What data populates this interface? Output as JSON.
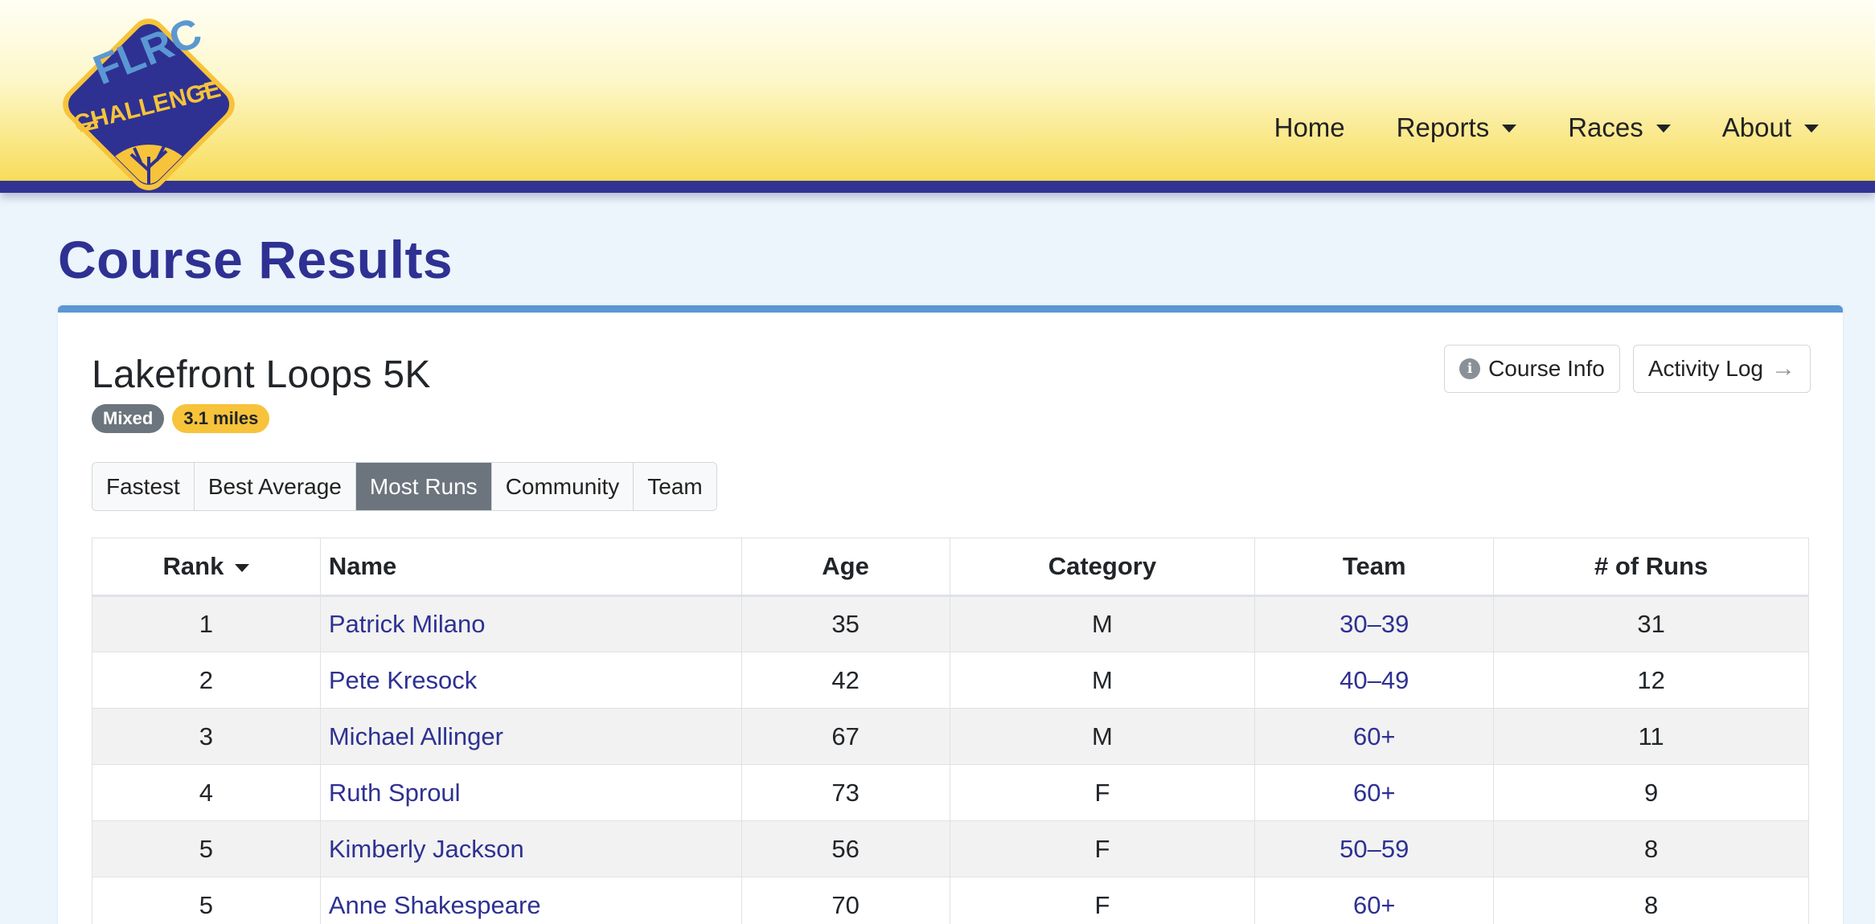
{
  "logo": {
    "line1": "FLRC",
    "line2": "CHALLENGE"
  },
  "nav": [
    {
      "label": "Home",
      "dropdown": false
    },
    {
      "label": "Reports",
      "dropdown": true
    },
    {
      "label": "Races",
      "dropdown": true
    },
    {
      "label": "About",
      "dropdown": true
    }
  ],
  "page_title": "Course Results",
  "course": {
    "name": "Lakefront Loops 5K",
    "badges": {
      "type": "Mixed",
      "distance": "3.1 miles"
    }
  },
  "buttons": {
    "course_info": "Course Info",
    "activity_log": "Activity Log"
  },
  "tabs": [
    "Fastest",
    "Best Average",
    "Most Runs",
    "Community",
    "Team"
  ],
  "active_tab": "Most Runs",
  "table": {
    "headers": {
      "rank": "Rank",
      "name": "Name",
      "age": "Age",
      "category": "Category",
      "team": "Team",
      "runs": "# of Runs"
    },
    "rows": [
      {
        "rank": "1",
        "name": "Patrick Milano",
        "age": "35",
        "category": "M",
        "team": "30–39",
        "runs": "31"
      },
      {
        "rank": "2",
        "name": "Pete Kresock",
        "age": "42",
        "category": "M",
        "team": "40–49",
        "runs": "12"
      },
      {
        "rank": "3",
        "name": "Michael Allinger",
        "age": "67",
        "category": "M",
        "team": "60+",
        "runs": "11"
      },
      {
        "rank": "4",
        "name": "Ruth Sproul",
        "age": "73",
        "category": "F",
        "team": "60+",
        "runs": "9"
      },
      {
        "rank": "5",
        "name": "Kimberly Jackson",
        "age": "56",
        "category": "F",
        "team": "50–59",
        "runs": "8"
      },
      {
        "rank": "5",
        "name": "Anne Shakespeare",
        "age": "70",
        "category": "F",
        "team": "60+",
        "runs": "8"
      }
    ]
  },
  "colors": {
    "brand_blue": "#2e3192",
    "accent_blue": "#5b97d3",
    "brand_yellow": "#f7c33a"
  }
}
